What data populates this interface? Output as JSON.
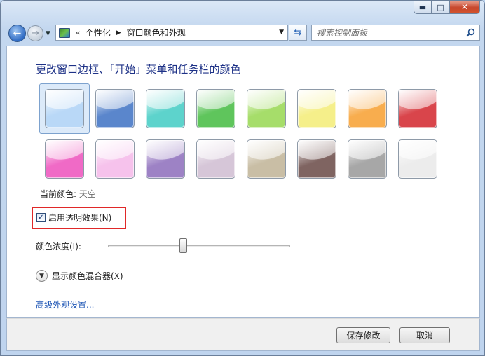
{
  "window": {
    "controls": {
      "minimize": "▬",
      "maximize": "□",
      "close": "✕"
    }
  },
  "nav": {
    "back_icon": "back-arrow-icon",
    "forward_icon": "forward-arrow-icon",
    "overflow": "«",
    "breadcrumbs": [
      "个性化",
      "窗口颜色和外观"
    ],
    "search_placeholder": "搜索控制面板"
  },
  "page": {
    "title": "更改窗口边框、「开始」菜单和任务栏的颜色",
    "swatches": [
      {
        "name": "sky",
        "color": "#b9d8f7",
        "selected": true
      },
      {
        "name": "twilight",
        "color": "#5a86cc"
      },
      {
        "name": "sea",
        "color": "#5dd3cc"
      },
      {
        "name": "leaf",
        "color": "#5fc55c"
      },
      {
        "name": "lime",
        "color": "#a6dd6a"
      },
      {
        "name": "lightning",
        "color": "#f5ef8a"
      },
      {
        "name": "pumpkin",
        "color": "#f8ad4e"
      },
      {
        "name": "ruby",
        "color": "#d9454b"
      },
      {
        "name": "fuchsia",
        "color": "#f06ac6"
      },
      {
        "name": "blush",
        "color": "#f6c2ec"
      },
      {
        "name": "violet",
        "color": "#9d82c5"
      },
      {
        "name": "lavender",
        "color": "#d6c6d8"
      },
      {
        "name": "taupe",
        "color": "#c9bea5"
      },
      {
        "name": "chocolate",
        "color": "#7f6461"
      },
      {
        "name": "slate",
        "color": "#a7a7a7"
      },
      {
        "name": "frost",
        "color": "#ececec"
      }
    ],
    "current_label": "当前颜色:",
    "current_value": "天空",
    "transparency_label": "启用透明效果(N)",
    "transparency_checked": "✓",
    "intensity_label": "颜色浓度(I):",
    "intensity_value": 0.41,
    "mixer_label": "显示颜色混合器(X)",
    "advanced_link": "高级外观设置..."
  },
  "footer": {
    "save_label": "保存修改",
    "cancel_label": "取消"
  }
}
